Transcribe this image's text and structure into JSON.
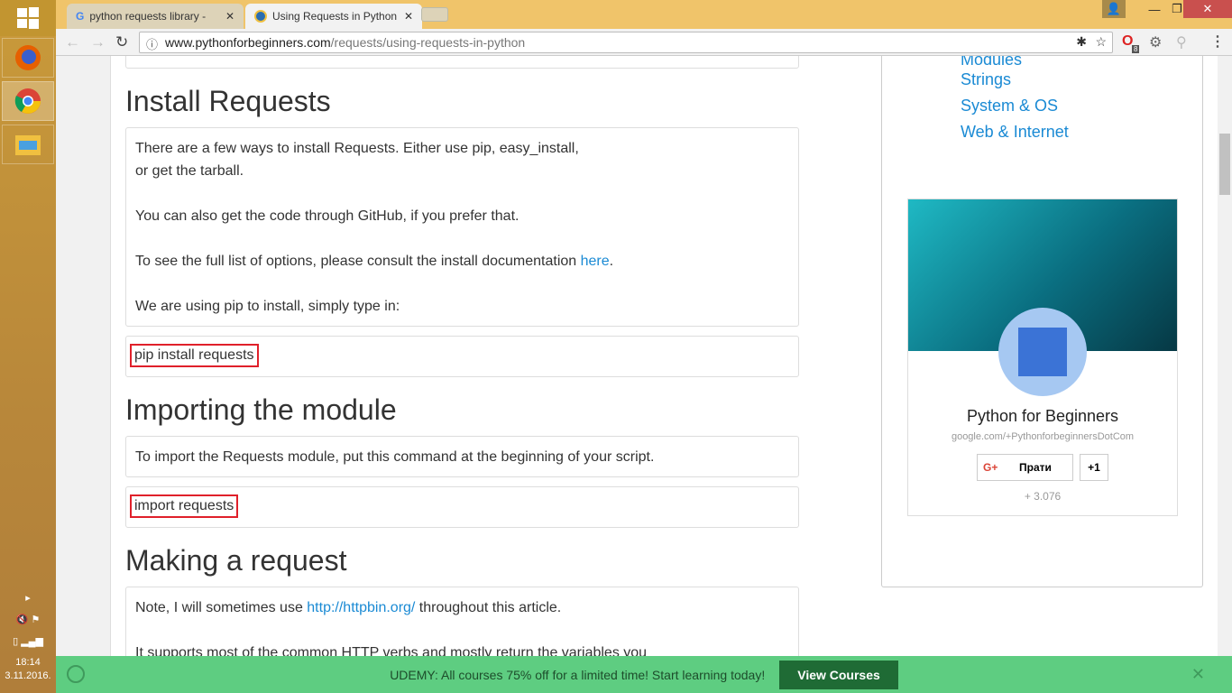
{
  "taskbar": {
    "time": "18:14",
    "date": "3.11.2016."
  },
  "browser": {
    "tabs": [
      {
        "title": "python requests library -"
      },
      {
        "title": "Using Requests in Python"
      }
    ],
    "url_domain": "www.pythonforbeginners.com",
    "url_path": "/requests/using-requests-in-python",
    "extension_badge": "8"
  },
  "sidebar": {
    "links": [
      "Modules",
      "Strings",
      "System & OS",
      "Web & Internet"
    ],
    "gplus": {
      "name": "Python for Beginners",
      "url": "google.com/+PythonforbeginnersDotCom",
      "follow": "Прати",
      "plus_one": "+1",
      "count": "+ 3.076"
    }
  },
  "content": {
    "h_install": "Install Requests",
    "p1": "There are a few ways to install Requests. Either use pip, easy_install,",
    "p1b": "or get the tarball.",
    "p2": "You can also get the code through GitHub, if you prefer that.",
    "p3": "To see the full list of options, please consult the install documentation ",
    "p3_link": "here",
    "p3_end": ".",
    "p4": "We are using pip to install, simply type in:",
    "code1": "pip install requests",
    "h_import": "Importing the module",
    "p5": "To import the Requests module, put this command at the beginning of your script.",
    "code2": "import requests",
    "h_request": "Making a request",
    "p6": "Note, I will sometimes use ",
    "p6_link": "http://httpbin.org/",
    "p6_end": " throughout this article.",
    "p7": "It supports most of the common HTTP verbs and mostly return the variables you"
  },
  "banner": {
    "text": "UDEMY: All courses 75% off for a limited time! Start learning today!",
    "button": "View Courses"
  }
}
